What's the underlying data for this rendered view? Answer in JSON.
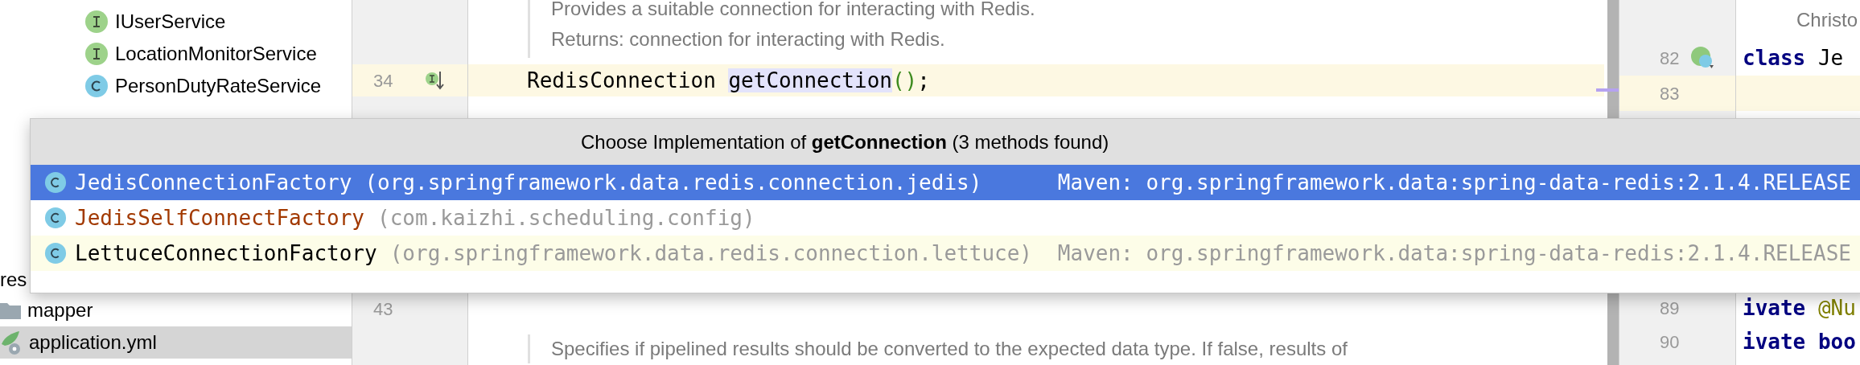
{
  "project_tree": {
    "items": [
      {
        "name": "IUserService",
        "kind": "interface",
        "selected": false
      },
      {
        "name": "LocationMonitorService",
        "kind": "interface",
        "selected": false
      },
      {
        "name": "PersonDutyRateService",
        "kind": "class",
        "selected": false
      }
    ],
    "lower_items": [
      {
        "name": "res",
        "kind": "text",
        "selected": false
      },
      {
        "name": "mapper",
        "kind": "folder",
        "selected": false
      },
      {
        "name": "application.yml",
        "kind": "yaml",
        "selected": true
      }
    ]
  },
  "editor": {
    "doc_top": [
      "Provides a suitable connection for interacting with Redis.",
      "Returns: connection for interacting with Redis."
    ],
    "current_line": {
      "number": "34",
      "return_type": "RedisConnection",
      "method": "getConnection",
      "parens": "()",
      "end": ";"
    },
    "lower_line_number": "43",
    "doc_bottom": "Specifies if pipelined results should be converted to the expected data type. If false, results of"
  },
  "right_editor": {
    "doc_fragment": "Christo",
    "lines": [
      {
        "number": "82",
        "keyword": "class",
        "rest": "Je",
        "current": false
      },
      {
        "number": "83",
        "current": true
      }
    ],
    "lower_lines": [
      {
        "number": "89",
        "keyword": "ivate",
        "annotation": "@Nu"
      },
      {
        "number": "90",
        "keyword": "ivate boo"
      }
    ]
  },
  "popup": {
    "title": "Choose Implementation of **getConnection** (3 methods found)",
    "items": [
      {
        "name": "JedisConnectionFactory",
        "package": "(org.springframework.data.redis.connection.jedis)",
        "library": "Maven: org.springframework.data:spring-data-redis:2.1.4.RELEASE",
        "kind": "library",
        "selected": true
      },
      {
        "name": "JedisSelfConnectFactory",
        "package": "(com.kaizhi.scheduling.config)",
        "kind": "project",
        "selected": false
      },
      {
        "name": "LettuceConnectionFactory",
        "package": "(org.springframework.data.redis.connection.lettuce)",
        "library": "Maven: org.springframework.data:spring-data-redis:2.1.4.RELEASE",
        "kind": "library",
        "selected": false
      }
    ]
  }
}
